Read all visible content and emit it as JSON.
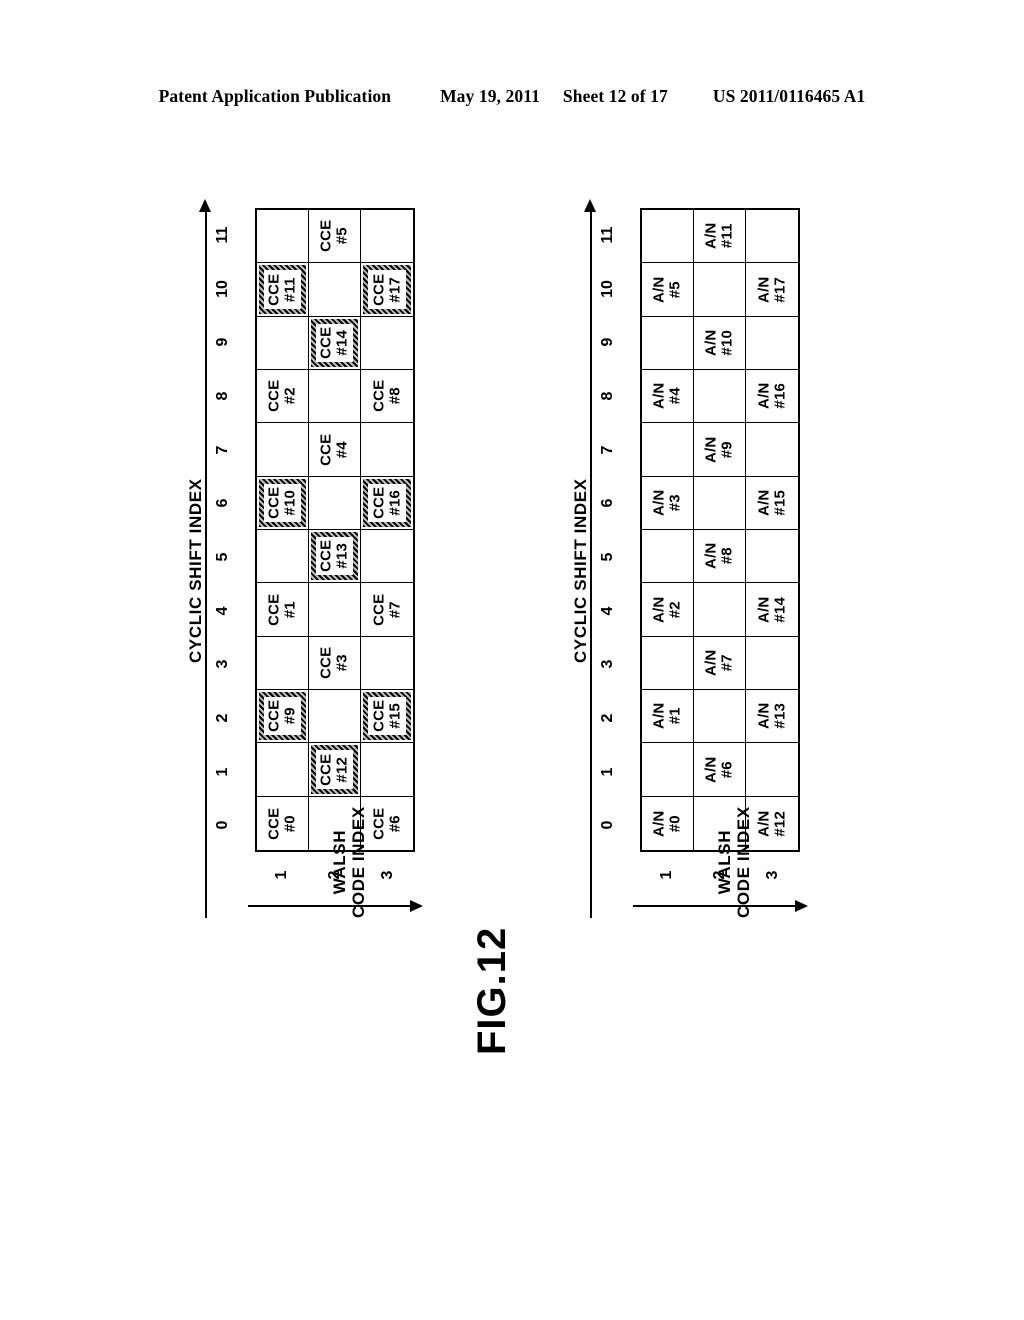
{
  "header": {
    "publication": "Patent Application Publication",
    "date": "May 19, 2011",
    "sheet": "Sheet 12 of 17",
    "doc_number": "US 2011/0116465 A1"
  },
  "figure": {
    "caption": "FIG.12"
  },
  "axes": {
    "cyclic_shift_title": "CYCLIC SHIFT INDEX",
    "cyclic_shift_ticks": [
      "0",
      "1",
      "2",
      "3",
      "4",
      "5",
      "6",
      "7",
      "8",
      "9",
      "10",
      "11"
    ],
    "walsh_title_line1": "WALSH",
    "walsh_title_line2": "CODE INDEX",
    "walsh_ticks": [
      "1",
      "2",
      "3"
    ]
  },
  "diagrams": [
    {
      "name": "cce-mapping",
      "rows": [
        {
          "walsh": "1",
          "cells": [
            {
              "label": "CCE\n#0",
              "highlighted": false
            },
            {
              "label": "",
              "highlighted": false
            },
            {
              "label": "CCE\n#9",
              "highlighted": true
            },
            {
              "label": "",
              "highlighted": false
            },
            {
              "label": "CCE\n#1",
              "highlighted": false
            },
            {
              "label": "",
              "highlighted": false
            },
            {
              "label": "CCE\n#10",
              "highlighted": true
            },
            {
              "label": "",
              "highlighted": false
            },
            {
              "label": "CCE\n#2",
              "highlighted": false
            },
            {
              "label": "",
              "highlighted": false
            },
            {
              "label": "CCE\n#11",
              "highlighted": true
            },
            {
              "label": "",
              "highlighted": false
            }
          ]
        },
        {
          "walsh": "2",
          "cells": [
            {
              "label": "",
              "highlighted": false
            },
            {
              "label": "CCE\n#12",
              "highlighted": true
            },
            {
              "label": "",
              "highlighted": false
            },
            {
              "label": "CCE\n#3",
              "highlighted": false
            },
            {
              "label": "",
              "highlighted": false
            },
            {
              "label": "CCE\n#13",
              "highlighted": true
            },
            {
              "label": "",
              "highlighted": false
            },
            {
              "label": "CCE\n#4",
              "highlighted": false
            },
            {
              "label": "",
              "highlighted": false
            },
            {
              "label": "CCE\n#14",
              "highlighted": true
            },
            {
              "label": "",
              "highlighted": false
            },
            {
              "label": "CCE\n#5",
              "highlighted": false
            }
          ]
        },
        {
          "walsh": "3",
          "cells": [
            {
              "label": "CCE\n#6",
              "highlighted": false
            },
            {
              "label": "",
              "highlighted": false
            },
            {
              "label": "CCE\n#15",
              "highlighted": true
            },
            {
              "label": "",
              "highlighted": false
            },
            {
              "label": "CCE\n#7",
              "highlighted": false
            },
            {
              "label": "",
              "highlighted": false
            },
            {
              "label": "CCE\n#16",
              "highlighted": true
            },
            {
              "label": "",
              "highlighted": false
            },
            {
              "label": "CCE\n#8",
              "highlighted": false
            },
            {
              "label": "",
              "highlighted": false
            },
            {
              "label": "CCE\n#17",
              "highlighted": true
            },
            {
              "label": "",
              "highlighted": false
            }
          ]
        }
      ]
    },
    {
      "name": "ack-nack-mapping",
      "rows": [
        {
          "walsh": "1",
          "cells": [
            {
              "label": "A/N\n#0",
              "highlighted": false
            },
            {
              "label": "",
              "highlighted": false
            },
            {
              "label": "A/N\n#1",
              "highlighted": false
            },
            {
              "label": "",
              "highlighted": false
            },
            {
              "label": "A/N\n#2",
              "highlighted": false
            },
            {
              "label": "",
              "highlighted": false
            },
            {
              "label": "A/N\n#3",
              "highlighted": false
            },
            {
              "label": "",
              "highlighted": false
            },
            {
              "label": "A/N\n#4",
              "highlighted": false
            },
            {
              "label": "",
              "highlighted": false
            },
            {
              "label": "A/N\n#5",
              "highlighted": false
            },
            {
              "label": "",
              "highlighted": false
            }
          ]
        },
        {
          "walsh": "2",
          "cells": [
            {
              "label": "",
              "highlighted": false
            },
            {
              "label": "A/N\n#6",
              "highlighted": false
            },
            {
              "label": "",
              "highlighted": false
            },
            {
              "label": "A/N\n#7",
              "highlighted": false
            },
            {
              "label": "",
              "highlighted": false
            },
            {
              "label": "A/N\n#8",
              "highlighted": false
            },
            {
              "label": "",
              "highlighted": false
            },
            {
              "label": "A/N\n#9",
              "highlighted": false
            },
            {
              "label": "",
              "highlighted": false
            },
            {
              "label": "A/N\n#10",
              "highlighted": false
            },
            {
              "label": "",
              "highlighted": false
            },
            {
              "label": "A/N\n#11",
              "highlighted": false
            }
          ]
        },
        {
          "walsh": "3",
          "cells": [
            {
              "label": "A/N\n#12",
              "highlighted": false
            },
            {
              "label": "",
              "highlighted": false
            },
            {
              "label": "A/N\n#13",
              "highlighted": false
            },
            {
              "label": "",
              "highlighted": false
            },
            {
              "label": "A/N\n#14",
              "highlighted": false
            },
            {
              "label": "",
              "highlighted": false
            },
            {
              "label": "A/N\n#15",
              "highlighted": false
            },
            {
              "label": "",
              "highlighted": false
            },
            {
              "label": "A/N\n#16",
              "highlighted": false
            },
            {
              "label": "",
              "highlighted": false
            },
            {
              "label": "A/N\n#17",
              "highlighted": false
            },
            {
              "label": "",
              "highlighted": false
            }
          ]
        }
      ]
    }
  ]
}
